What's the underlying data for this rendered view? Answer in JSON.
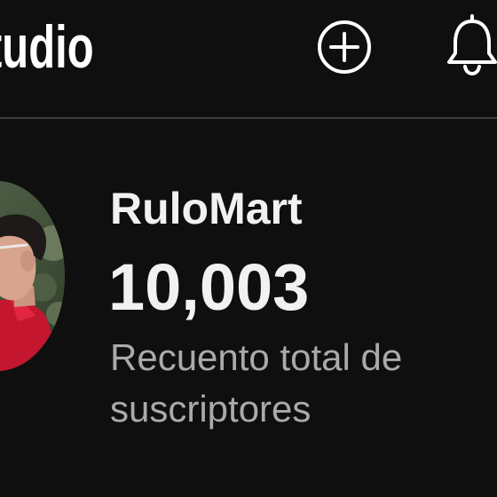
{
  "header": {
    "app_title": "tudio",
    "create_icon": "plus-circle-icon",
    "notifications_icon": "bell-icon"
  },
  "channel": {
    "name": "RuloMart",
    "subscriber_count": "10,003",
    "subscriber_caption": "Recuento total de suscriptores",
    "avatar": "channel-avatar-photo"
  },
  "colors": {
    "background": "#0f0f0f",
    "text_primary": "#f1f1f1",
    "text_secondary": "#aaaaaa",
    "divider": "#3e3e3e"
  }
}
